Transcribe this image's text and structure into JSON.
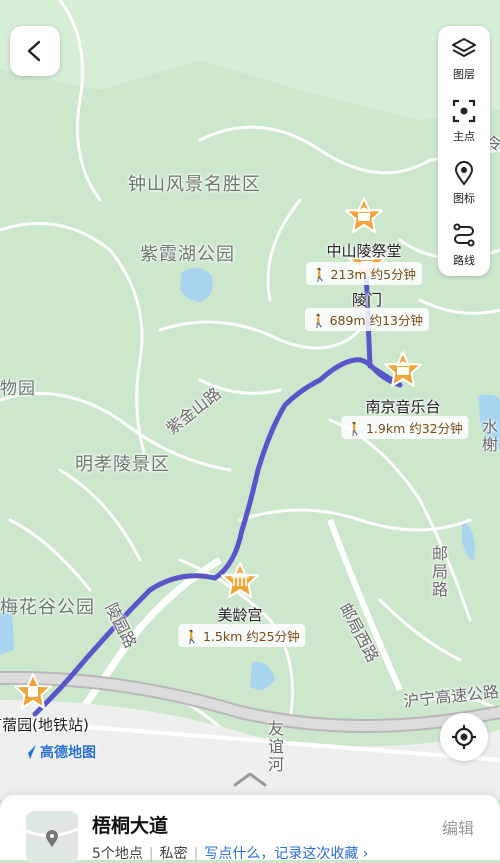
{
  "map_labels": {
    "zhongshan": "钟山风景名胜区",
    "zixia": "紫霞湖公园",
    "wuyuan": "物园",
    "zijinshan": "紫金山路",
    "mingxiaoling": "明孝陵景区",
    "meihuagu": "梅花谷公园",
    "lingyuan": "陵园路",
    "youhu": "邮局路",
    "youhu2": "邮局西路",
    "huning": "沪宁高速公路",
    "youyihe": "友谊河",
    "shui": "水榭",
    "ling": "令"
  },
  "pois": [
    {
      "name": "中山陵祭堂",
      "walk": "213m 约5分钟",
      "icon": "gate"
    },
    {
      "name": "陵门",
      "walk": "689m 约13分钟",
      "icon": "gate"
    },
    {
      "name": "南京音乐台",
      "walk": "1.9km 约32分钟",
      "icon": "gate"
    },
    {
      "name": "美龄宫",
      "walk": "1.5km 约25分钟",
      "icon": "museum"
    },
    {
      "name": "苜蓿园(地铁站)",
      "walk": "",
      "icon": "metro"
    }
  ],
  "toolbar": {
    "layers": "图层",
    "main_point": "主点",
    "markers": "图标",
    "route": "路线"
  },
  "logo": "高德地图",
  "sheet": {
    "title": "梧桐大道",
    "count": "5个地点",
    "privacy": "私密",
    "prompt": "写点什么，记录这次收藏",
    "edit": "编辑"
  },
  "colors": {
    "route": "#5a55c8",
    "poi": "#f0a63a",
    "accent": "#2a6fd6"
  }
}
